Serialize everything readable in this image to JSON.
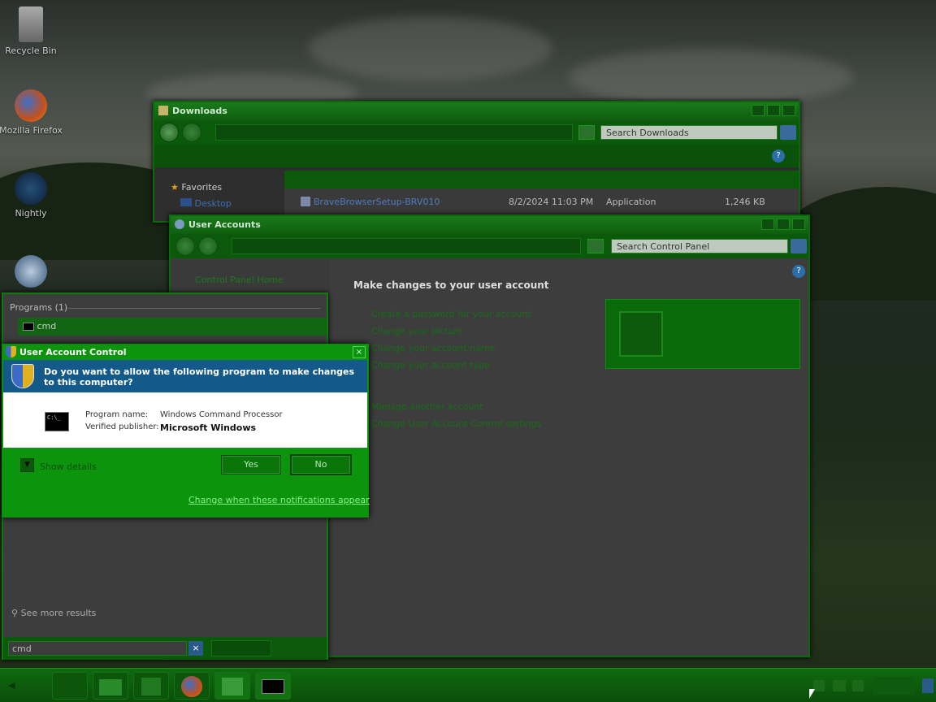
{
  "desktop": {
    "icons": [
      {
        "label": "Recycle Bin",
        "icon": "recycle-bin-icon"
      },
      {
        "label": "Mozilla Firefox",
        "icon": "firefox-icon"
      },
      {
        "label": "Nightly",
        "icon": "nightly-icon"
      }
    ]
  },
  "downloads_window": {
    "title": "Downloads",
    "search_placeholder": "Search Downloads",
    "sidebar": {
      "favorites": "Favorites",
      "desktop": "Desktop"
    },
    "file": {
      "name": "BraveBrowserSetup-BRV010",
      "date": "8/2/2024 11:03 PM",
      "type": "Application",
      "size": "1,246 KB"
    }
  },
  "user_accounts_window": {
    "title": "User Accounts",
    "search_placeholder": "Search Control Panel",
    "side_link": "Control Panel Home",
    "heading": "Make changes to your user account",
    "links": [
      "Create a password for your account",
      "Change your picture",
      "Change your account name",
      "Change your account type"
    ],
    "links2": [
      "Manage another account",
      "Change User Account Control settings"
    ]
  },
  "start_menu": {
    "programs_header": "Programs (1)",
    "result": "cmd",
    "see_more": "See more results",
    "search_value": "cmd"
  },
  "uac": {
    "title": "User Account Control",
    "question": "Do you want to allow the following program to make changes to this computer?",
    "program_name_label": "Program name:",
    "program_name": "Windows Command Processor",
    "publisher_label": "Verified publisher:",
    "publisher": "Microsoft Windows",
    "show_details": "Show details",
    "yes": "Yes",
    "no": "No",
    "notify_link": "Change when these notifications appear"
  },
  "colors": {
    "accent": "#0d940d",
    "header_blue": "#135a8a"
  }
}
